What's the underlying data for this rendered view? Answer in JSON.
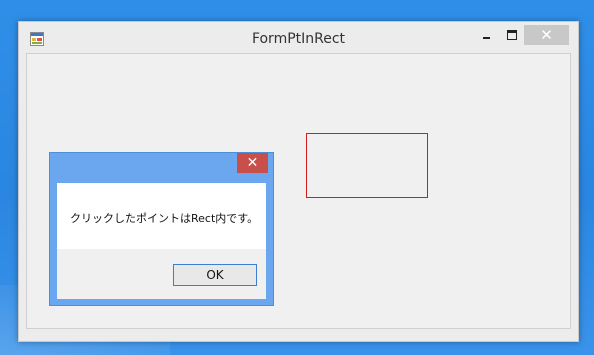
{
  "main_window": {
    "title": "FormPtInRect",
    "app_icon": "app-form-icon",
    "controls": {
      "minimize_icon": "minimize-icon",
      "maximize_icon": "maximize-icon",
      "close_glyph": "✕",
      "close_icon": "close-icon"
    },
    "rect_border_color": "#d61b1b"
  },
  "message_box": {
    "message": "クリックしたポイントはRect内です。",
    "close_glyph": "✕",
    "close_icon": "close-icon",
    "ok_label": "OK"
  },
  "colors": {
    "desktop": "#2a86e0",
    "dialog_frame": "#6aa7ee",
    "dialog_close": "#c9504a"
  }
}
